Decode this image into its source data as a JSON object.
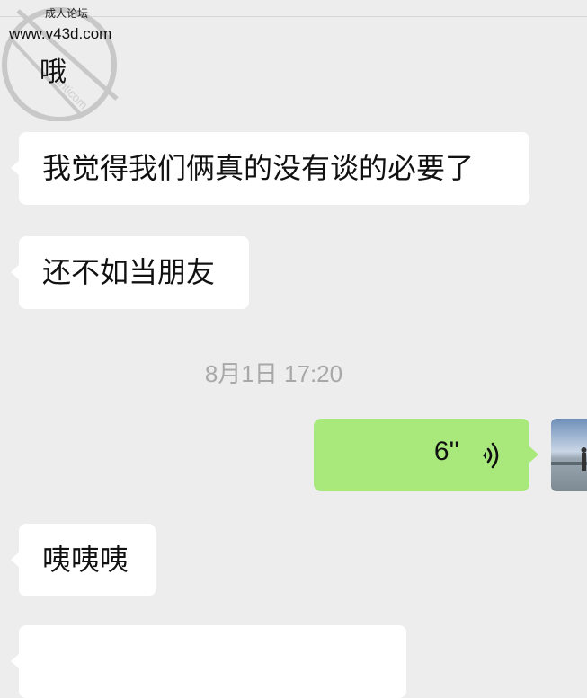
{
  "watermark": {
    "site_name": "成人论坛",
    "url": "www.v43d.com"
  },
  "chat": {
    "partial_message": "哦",
    "messages": [
      {
        "text": "我觉得我们俩真的没有谈的必要了"
      },
      {
        "text": "还不如当朋友"
      }
    ],
    "timestamp": "8月1日 17:20",
    "voice_message": {
      "duration": "6''"
    },
    "later_messages": [
      {
        "text": "咦咦咦"
      }
    ]
  },
  "colors": {
    "background": "#ededed",
    "incoming_bubble": "#ffffff",
    "outgoing_bubble": "#a9e97c",
    "timestamp_text": "#a8a8a8"
  },
  "icons": {
    "voice": "voice-wave-icon",
    "avatar": "avatar"
  }
}
